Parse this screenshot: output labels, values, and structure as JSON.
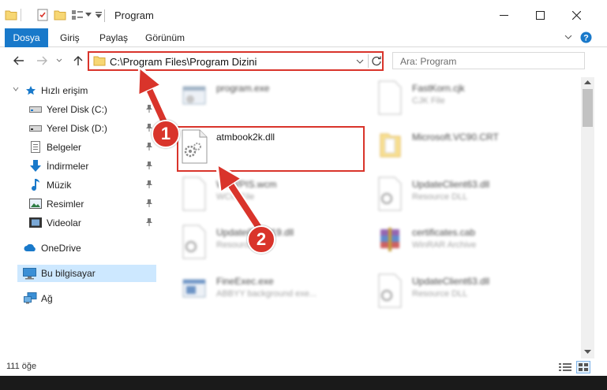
{
  "window": {
    "title": "Program"
  },
  "ribbon": {
    "tabs": [
      "Dosya",
      "Giriş",
      "Paylaş",
      "Görünüm"
    ]
  },
  "address": {
    "path": "C:\\Program Files\\Program Dizini",
    "search_placeholder": "Ara: Program"
  },
  "nav": {
    "quick_access": "Hızlı erişim",
    "items": [
      "Yerel Disk (C:)",
      "Yerel Disk (D:)",
      "Belgeler",
      "İndirmeler",
      "Müzik",
      "Resimler",
      "Videolar"
    ],
    "onedrive": "OneDrive",
    "this_pc": "Bu bilgisayar",
    "network": "Ağ"
  },
  "files": {
    "left": [
      {
        "name": "program.exe",
        "type": ""
      },
      {
        "name": "atmbook2k.dll",
        "type": ""
      },
      {
        "name": "WoWPIS.wcm",
        "type": "WCM File"
      },
      {
        "name": "UpdateClient19.dll",
        "type": "Resource DLL"
      },
      {
        "name": "FineExec.exe",
        "type": "ABBYY background exe..."
      }
    ],
    "right": [
      {
        "name": "FastKorn.cjk",
        "type": "CJK File"
      },
      {
        "name": "Microsoft.VC90.CRT",
        "type": ""
      },
      {
        "name": "UpdateClient63.dll",
        "type": "Resource DLL"
      },
      {
        "name": "certificates.cab",
        "type": "WinRAR Archive"
      },
      {
        "name": "UpdateClient63.dll",
        "type": "Resource DLL"
      }
    ]
  },
  "status": {
    "count": "111 öğe"
  },
  "badges": {
    "step1": "1",
    "step2": "2"
  },
  "colors": {
    "accent": "#1979ca",
    "highlight": "#d9342b",
    "selected": "#cde8ff"
  }
}
